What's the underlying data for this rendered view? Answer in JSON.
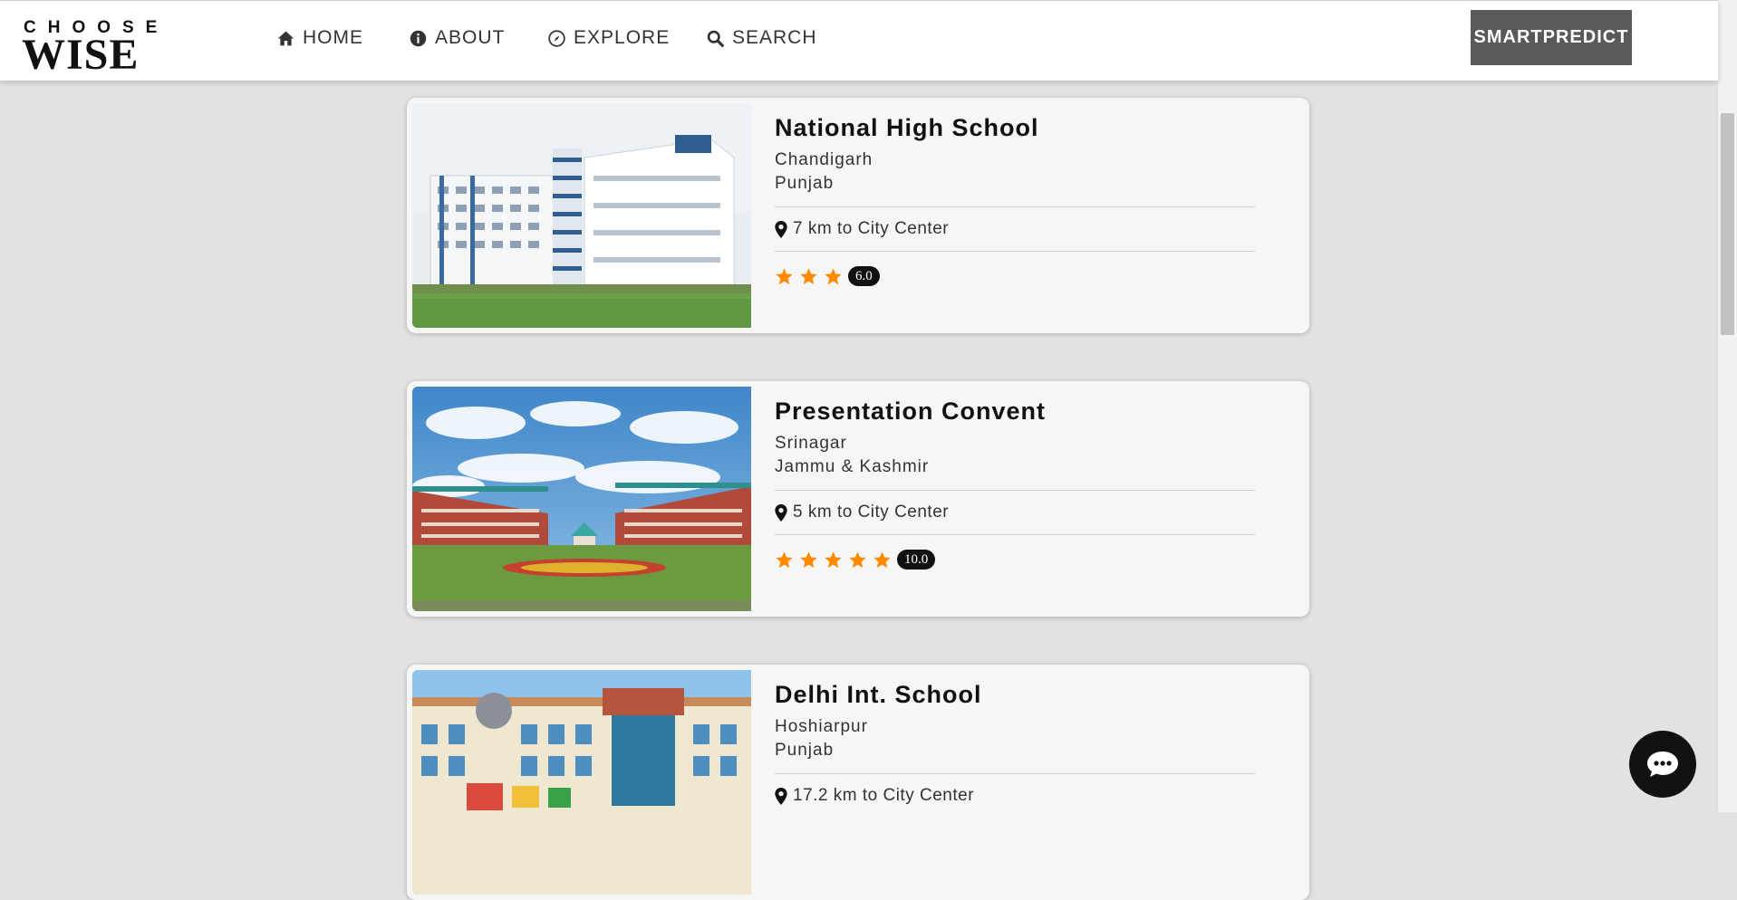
{
  "logo": {
    "top_text": "CHOOSE",
    "bottom_text": "WISE"
  },
  "nav": {
    "items": [
      {
        "label": "HOME",
        "icon": "home-icon"
      },
      {
        "label": "ABOUT",
        "icon": "info-icon"
      },
      {
        "label": "EXPLORE",
        "icon": "compass-icon"
      },
      {
        "label": "SEARCH",
        "icon": "search-icon"
      }
    ],
    "cta_label": "SMARTPREDICT"
  },
  "schools": [
    {
      "name": "National High School",
      "city": "Chandigarh",
      "state": "Punjab",
      "distance": "7 km to City Center",
      "stars": 3,
      "score": "6.0"
    },
    {
      "name": "Presentation Convent",
      "city": "Srinagar",
      "state": "Jammu & Kashmir",
      "distance": "5 km to City Center",
      "stars": 5,
      "score": "10.0"
    },
    {
      "name": "Delhi Int. School",
      "city": "Hoshiarpur",
      "state": "Punjab",
      "distance": "17.2 km to City Center",
      "stars": null,
      "score": null
    }
  ],
  "colors": {
    "star": "#ff8a00",
    "cta_bg": "#595959",
    "page_bg": "#e2e2e2",
    "card_bg": "#f6f6f6"
  },
  "chat": {
    "icon": "chat-bubble-icon"
  }
}
